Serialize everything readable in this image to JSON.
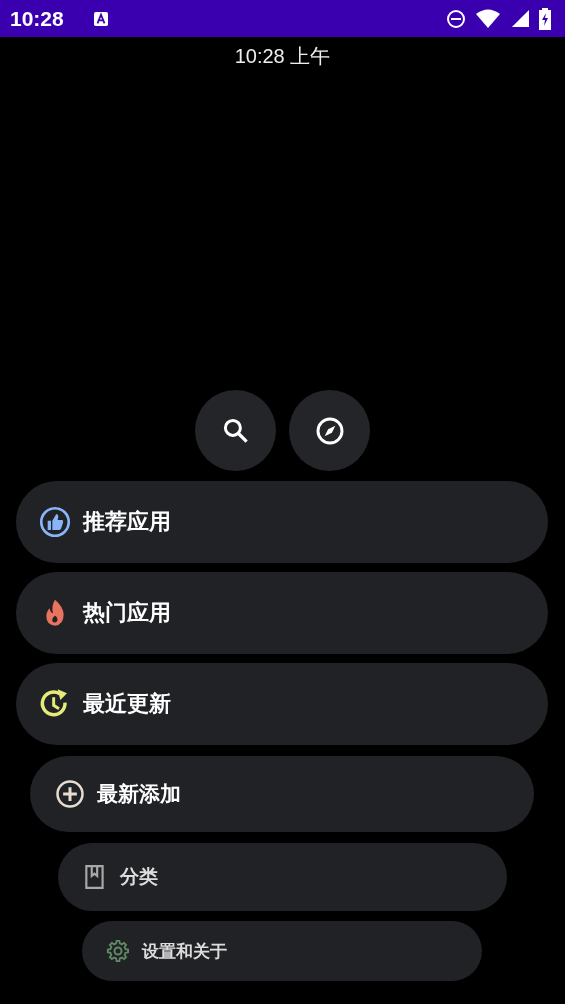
{
  "status_bar": {
    "time": "10:28"
  },
  "clock": "10:28 上午",
  "quick_buttons": [
    {
      "kind": "search"
    },
    {
      "kind": "compass"
    }
  ],
  "menu": [
    {
      "label": "推荐应用",
      "kind": "thumb",
      "color": "#8ab4f8"
    },
    {
      "label": "热门应用",
      "kind": "fire",
      "color": "#e8735f"
    },
    {
      "label": "最近更新",
      "kind": "history",
      "color": "#e6ea7a"
    },
    {
      "label": "最新添加",
      "kind": "add",
      "color": "#e8dcd0"
    },
    {
      "label": "分类",
      "kind": "book",
      "color": "#a8a8a8"
    },
    {
      "label": "设置和关于",
      "kind": "gear",
      "color": "#5f8a62"
    }
  ]
}
